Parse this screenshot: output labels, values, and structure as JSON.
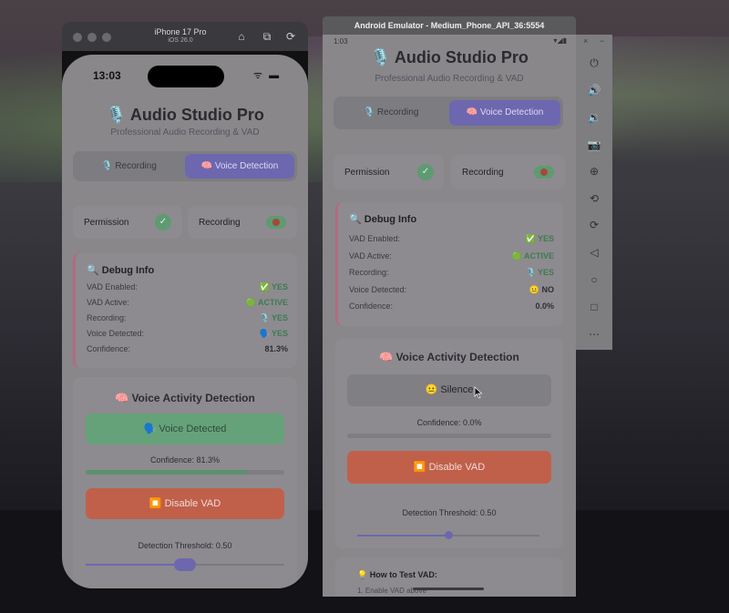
{
  "iphone": {
    "window_title": "iPhone 17 Pro",
    "window_subtitle": "iOS 26.0",
    "time": "13:03",
    "status_icons": "ᯤ ▬",
    "app": {
      "title": "🎙️ Audio Studio Pro",
      "subtitle": "Professional Audio Recording & VAD",
      "tabs": [
        {
          "label": "🎙️ Recording",
          "active": false
        },
        {
          "label": "🧠 Voice Detection",
          "active": true
        }
      ],
      "status": {
        "permission_label": "Permission",
        "permission_icon": "✓",
        "recording_label": "Recording"
      },
      "debug": {
        "title": "🔍 Debug Info",
        "rows": [
          {
            "label": "VAD Enabled:",
            "value": "✅ YES"
          },
          {
            "label": "VAD Active:",
            "value": "🟢 ACTIVE"
          },
          {
            "label": "Recording:",
            "value": "🎙️ YES"
          },
          {
            "label": "Voice Detected:",
            "value": "🗣️ YES"
          },
          {
            "label": "Confidence:",
            "value": "81.3%"
          }
        ]
      },
      "vad": {
        "title": "🧠 Voice Activity Detection",
        "state_label": "🗣️ Voice Detected",
        "confidence_label": "Confidence: 81.3%",
        "confidence": 0.813,
        "toggle_label": "⏹️ Disable VAD",
        "threshold_label": "Detection Threshold: 0.50",
        "threshold": 0.5
      }
    }
  },
  "android": {
    "window_title": "Android Emulator - Medium_Phone_API_36:5554",
    "time": "1:03",
    "status_icons": "▾◢▮",
    "panel_controls": [
      "×",
      "−"
    ],
    "panel_icons": [
      "power-icon",
      "volume-up-icon",
      "volume-down-icon",
      "camera-icon",
      "zoom-icon",
      "rotate-left-icon",
      "rotate-right-icon",
      "back-icon",
      "home-icon",
      "overview-icon",
      "more-icon"
    ],
    "panel_glyphs": [
      "⏻",
      "🔊",
      "🔉",
      "📷",
      "⊕",
      "⟲",
      "⟳",
      "◁",
      "○",
      "□",
      "⋯"
    ],
    "app": {
      "title": "🎙️ Audio Studio Pro",
      "subtitle": "Professional Audio Recording & VAD",
      "tabs": [
        {
          "label": "🎙️ Recording",
          "active": false
        },
        {
          "label": "🧠 Voice Detection",
          "active": true
        }
      ],
      "status": {
        "permission_label": "Permission",
        "permission_icon": "✓",
        "recording_label": "Recording"
      },
      "debug": {
        "title": "🔍 Debug Info",
        "rows": [
          {
            "label": "VAD Enabled:",
            "value": "✅ YES"
          },
          {
            "label": "VAD Active:",
            "value": "🟢 ACTIVE"
          },
          {
            "label": "Recording:",
            "value": "🎙️ YES"
          },
          {
            "label": "Voice Detected:",
            "value": "😐 NO"
          },
          {
            "label": "Confidence:",
            "value": "0.0%"
          }
        ]
      },
      "vad": {
        "title": "🧠 Voice Activity Detection",
        "state_label": "😐 Silence",
        "confidence_label": "Confidence: 0.0%",
        "confidence": 0.0,
        "toggle_label": "⏹️ Disable VAD",
        "threshold_label": "Detection Threshold: 0.50",
        "threshold": 0.5
      },
      "howto": {
        "title": "💡 How to Test VAD:",
        "step1": "1. Enable VAD above"
      }
    }
  },
  "colors": {
    "accent": "#6d67b0",
    "success": "#5e9a72",
    "danger": "#c0604a",
    "debug_border": "#b06b82"
  }
}
